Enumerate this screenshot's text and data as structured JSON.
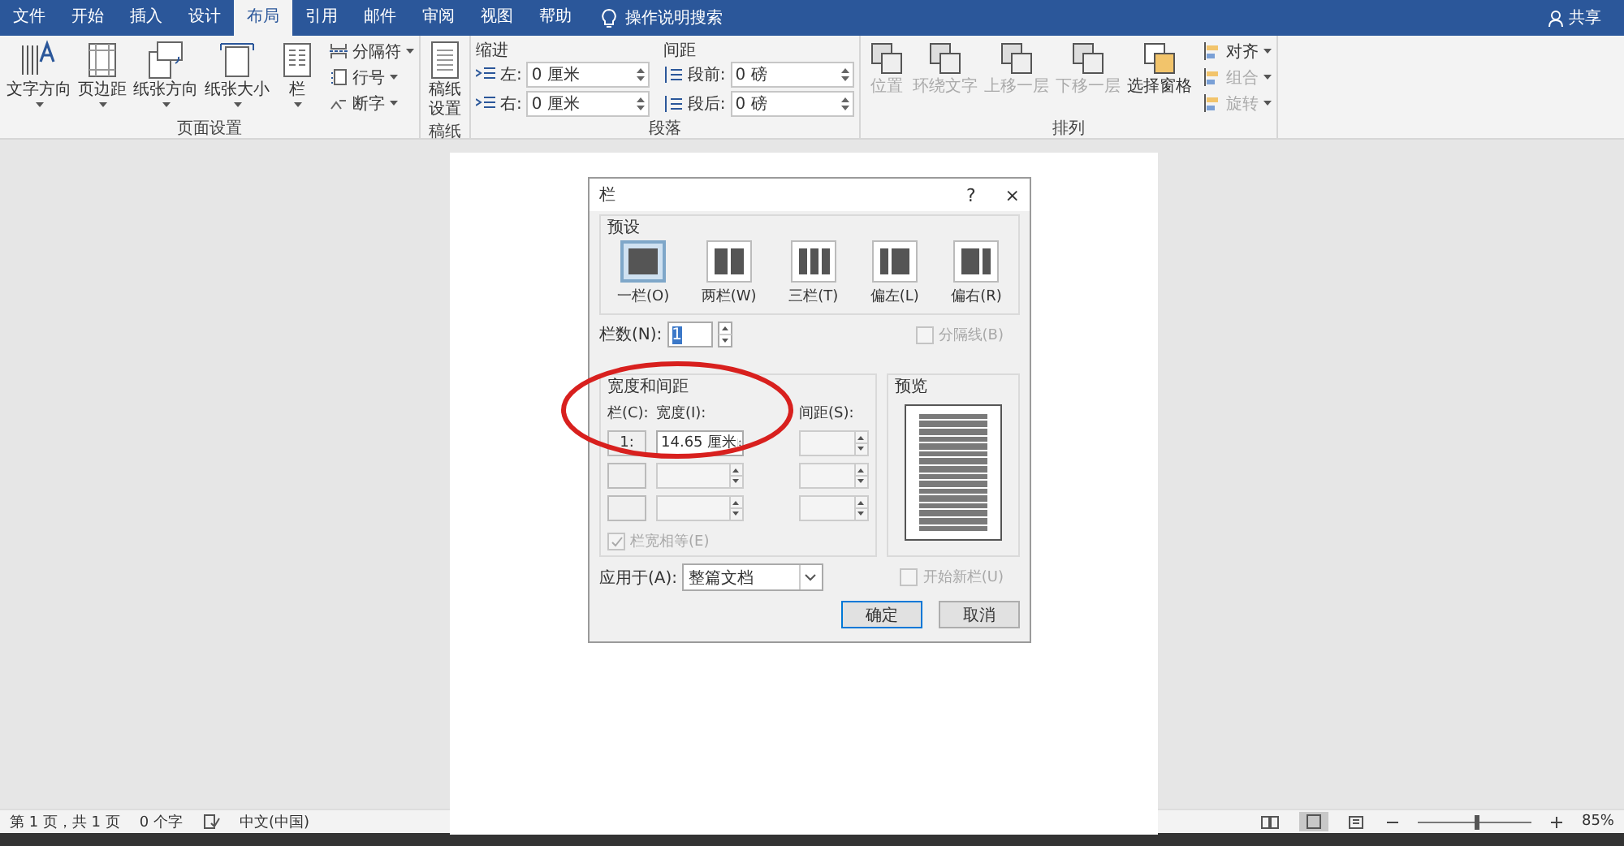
{
  "tabs": [
    {
      "label": "文件",
      "selected": false
    },
    {
      "label": "开始",
      "selected": false
    },
    {
      "label": "插入",
      "selected": false
    },
    {
      "label": "设计",
      "selected": false
    },
    {
      "label": "布局",
      "selected": true
    },
    {
      "label": "引用",
      "selected": false
    },
    {
      "label": "邮件",
      "selected": false
    },
    {
      "label": "审阅",
      "selected": false
    },
    {
      "label": "视图",
      "selected": false
    },
    {
      "label": "帮助",
      "selected": false
    }
  ],
  "tell_me": "操作说明搜索",
  "share": "共享",
  "ribbon": {
    "page_setup": {
      "label": "页面设置",
      "large_buttons": [
        {
          "label": "文字方向",
          "kind": "textdir"
        },
        {
          "label": "页边距",
          "kind": "margins"
        },
        {
          "label": "纸张方向",
          "kind": "orient"
        },
        {
          "label": "纸张大小",
          "kind": "size"
        },
        {
          "label": "栏",
          "kind": "columns"
        }
      ],
      "small_buttons": [
        {
          "label": "分隔符",
          "kind": "breaks"
        },
        {
          "label": "行号",
          "kind": "linenum"
        },
        {
          "label": "断字",
          "kind": "hyphen"
        }
      ]
    },
    "manuscript": {
      "label": "稿纸",
      "button": "稿纸设置"
    },
    "paragraph": {
      "label": "段落",
      "indent_heading": "缩进",
      "spacing_heading": "间距",
      "indent": [
        {
          "label": "左:",
          "value": "0 厘米"
        },
        {
          "label": "右:",
          "value": "0 厘米"
        }
      ],
      "spacing": [
        {
          "label": "段前:",
          "value": "0 磅"
        },
        {
          "label": "段后:",
          "value": "0 磅"
        }
      ]
    },
    "arrange": {
      "label": "排列",
      "large_buttons": [
        {
          "label": "位置",
          "disabled": true
        },
        {
          "label": "环绕文字",
          "disabled": true
        },
        {
          "label": "上移一层",
          "disabled": true
        },
        {
          "label": "下移一层",
          "disabled": true
        },
        {
          "label": "选择窗格",
          "disabled": false
        }
      ],
      "small_buttons": [
        {
          "label": "对齐",
          "disabled": false
        },
        {
          "label": "组合",
          "disabled": true
        },
        {
          "label": "旋转",
          "disabled": true
        }
      ]
    }
  },
  "dialog": {
    "title": "栏",
    "help": "?",
    "close": "×",
    "presets_label": "预设",
    "presets": [
      {
        "label": "一栏(O)",
        "kind": "one",
        "selected": true
      },
      {
        "label": "两栏(W)",
        "kind": "two",
        "selected": false
      },
      {
        "label": "三栏(T)",
        "kind": "three",
        "selected": false
      },
      {
        "label": "偏左(L)",
        "kind": "left",
        "selected": false
      },
      {
        "label": "偏右(R)",
        "kind": "right",
        "selected": false
      }
    ],
    "count_label": "栏数(N):",
    "count_value": "1",
    "separator": {
      "label": "分隔线(B)",
      "checked": false,
      "disabled": true
    },
    "width_group_label": "宽度和间距",
    "col_header": "栏(C):",
    "width_header": "宽度(I):",
    "spacing_header": "间距(S):",
    "rows": [
      {
        "num": "1:",
        "width": "14.65 厘米"
      },
      {},
      {}
    ],
    "equal_width": {
      "label": "栏宽相等(E)",
      "checked": true,
      "disabled": true
    },
    "preview_label": "预览",
    "apply_label": "应用于(A):",
    "apply_value": "整篇文档",
    "new_column": {
      "label": "开始新栏(U)",
      "checked": false,
      "disabled": true
    },
    "ok": "确定",
    "cancel": "取消"
  },
  "status_bar": {
    "page": "第 1 页，共 1 页",
    "words": "0 个字",
    "language": "中文(中国)",
    "zoom": "85%",
    "zoom_slider": {
      "level": 0.5
    }
  }
}
